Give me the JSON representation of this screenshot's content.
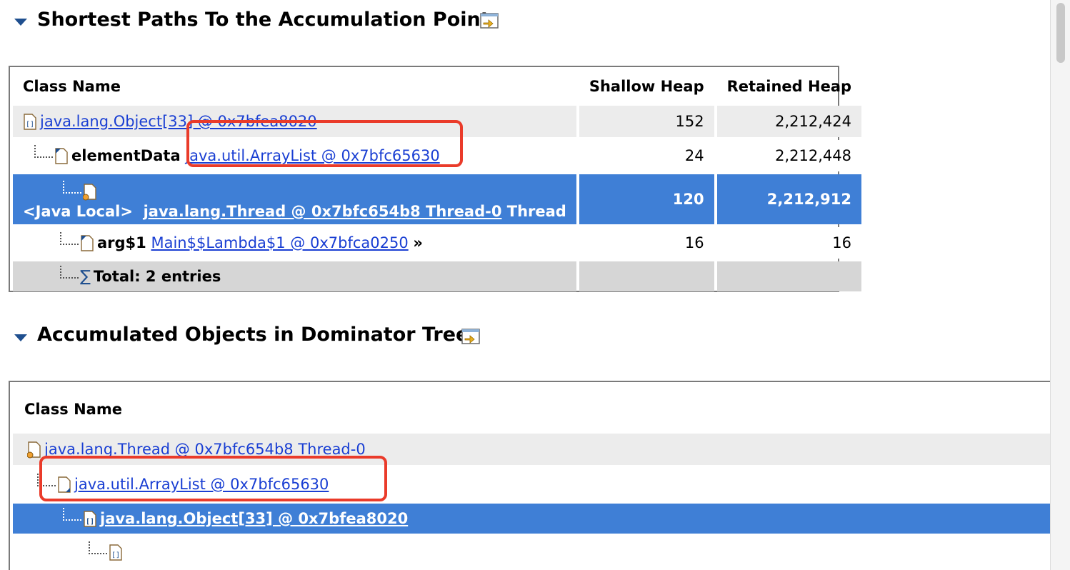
{
  "section1": {
    "title": "Shortest Paths To the Accumulation Point",
    "columns": [
      "Class Name",
      "Shallow Heap",
      "Retained Heap"
    ],
    "rows": [
      {
        "prefix": "",
        "link": "java.lang.Object[33] @ 0x7bfea8020",
        "suffix": "",
        "shallow": "152",
        "retained": "2,212,424"
      },
      {
        "prefix": "elementData",
        "link": "java.util.ArrayList @ 0x7bfc65630",
        "suffix": "",
        "shallow": "24",
        "retained": "2,212,448"
      },
      {
        "prefix": "<Java Local>",
        "link": "java.lang.Thread @ 0x7bfc654b8 Thread-0",
        "suffix": "Thread",
        "shallow": "120",
        "retained": "2,212,912"
      },
      {
        "prefix": "arg$1",
        "link": "Main$$Lambda$1 @ 0x7bfca0250",
        "suffix": "»",
        "shallow": "16",
        "retained": "16"
      }
    ],
    "total": "Total: 2 entries"
  },
  "section2": {
    "title": "Accumulated Objects in Dominator Tree",
    "columns": [
      "Class Name"
    ],
    "rows": [
      {
        "link": "java.lang.Thread @ 0x7bfc654b8 Thread-0"
      },
      {
        "link": "java.util.ArrayList @ 0x7bfc65630"
      },
      {
        "link": "java.lang.Object[33] @ 0x7bfea8020"
      },
      {
        "link": ""
      }
    ]
  },
  "colors": {
    "selection": "#3f7fd6",
    "link": "#1a3fd3",
    "highlight": "#ea3b2a"
  },
  "icons": [
    "collapse-twisty-icon",
    "export-icon",
    "array-object-icon",
    "object-document-icon",
    "thread-object-icon",
    "sum-icon"
  ]
}
